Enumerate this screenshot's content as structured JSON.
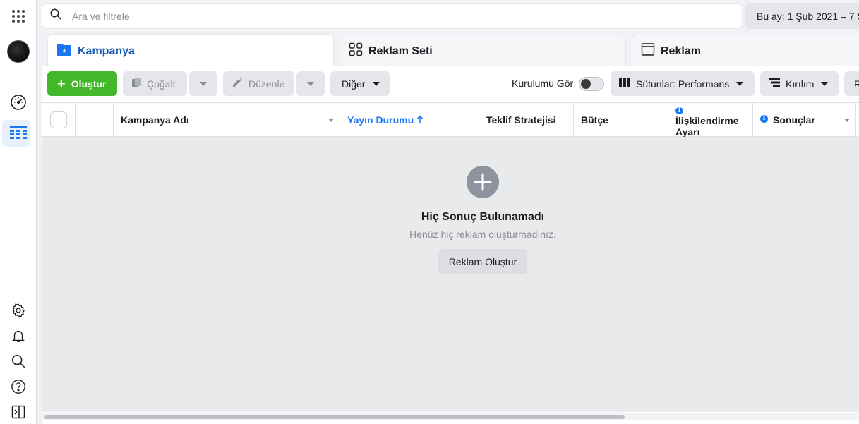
{
  "search": {
    "placeholder": "Ara ve filtrele"
  },
  "date_range": {
    "label": "Bu ay: 1 Şub 2021 – 7 Ş"
  },
  "tabs": [
    {
      "label": "Kampanya",
      "active": true
    },
    {
      "label": "Reklam Seti",
      "active": false
    },
    {
      "label": "Reklam",
      "active": false
    }
  ],
  "toolbar": {
    "create_label": "Oluştur",
    "duplicate_label": "Çoğalt",
    "edit_label": "Düzenle",
    "more_label": "Diğer",
    "view_setup_label": "Kurulumu Gör",
    "view_setup_on": false,
    "columns_label": "Sütunlar: Performans",
    "breakdown_label": "Kırılım",
    "overflow_label": "R"
  },
  "table": {
    "columns": [
      {
        "label": "Kampanya Adı"
      },
      {
        "label": "Yayın Durumu",
        "sorted": "asc"
      },
      {
        "label": "Teklif Stratejisi"
      },
      {
        "label": "Bütçe"
      },
      {
        "label": "İlişkilendirme Ayarı"
      },
      {
        "label": "Sonuçlar"
      }
    ]
  },
  "empty_state": {
    "title": "Hiç Sonuç Bulunamadı",
    "subtitle": "Henüz hiç reklam oluşturmadınız.",
    "button_label": "Reklam Oluştur"
  },
  "colors": {
    "accent": "#1877f2",
    "tab_active_text": "#1a5fb4",
    "create_button": "#42b72a",
    "sort_active_text": "#1877f2"
  },
  "icons": [
    "apps-grid-icon",
    "account-avatar",
    "dashboard-gauge-icon",
    "ads-manager-table-icon",
    "gear-icon",
    "bell-icon",
    "search-icon",
    "help-icon",
    "sidebar-toggle-icon"
  ]
}
